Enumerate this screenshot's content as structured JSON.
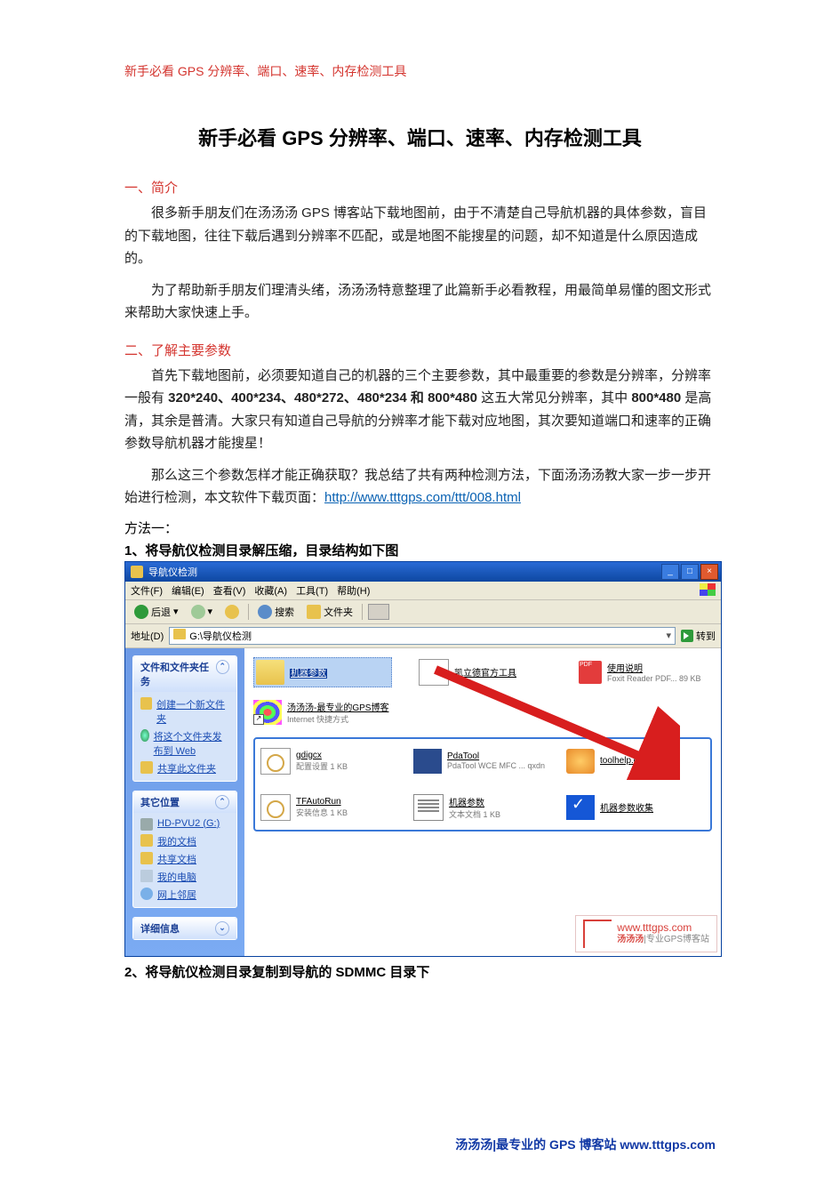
{
  "header": "新手必看 GPS 分辨率、端口、速率、内存检测工具",
  "main_title": "新手必看 GPS 分辨率、端口、速率、内存检测工具",
  "section1": {
    "heading": "一、简介",
    "p1": "很多新手朋友们在汤汤汤 GPS 博客站下载地图前，由于不清楚自己导航机器的具体参数，盲目的下载地图，往往下载后遇到分辨率不匹配，或是地图不能搜星的问题，却不知道是什么原因造成的。",
    "p2": "为了帮助新手朋友们理清头绪，汤汤汤特意整理了此篇新手必看教程，用最简单易懂的图文形式来帮助大家快速上手。"
  },
  "section2": {
    "heading": "二、了解主要参数",
    "p1_a": "首先下载地图前，必须要知道自己的机器的三个主要参数，其中最重要的参数是分辨率，分辨率一般有 ",
    "p1_bold": "320*240、400*234、480*272、480*234 和 800*480",
    "p1_b": " 这五大常见分辨率，其中 ",
    "p1_bold2": "800*480",
    "p1_c": " 是高清，其余是普清。大家只有知道自己导航的分辨率才能下载对应地图，其次要知道端口和速率的正确参数导航机器才能搜星！",
    "p2_a": "那么这三个参数怎样才能正确获取？我总结了共有两种检测方法，下面汤汤汤教大家一步一步开始进行检测，本文软件下载页面：",
    "p2_link": "http://www.tttgps.com/ttt/008.html"
  },
  "method1": {
    "label": "方法一：",
    "step1": "1、将导航仪检测目录解压缩，目录结构如下图",
    "step2": "2、将导航仪检测目录复制到导航的 SDMMC 目录下"
  },
  "footer": "汤汤汤|最专业的 GPS 博客站 www.tttgps.com",
  "xp": {
    "title": "导航仪检测",
    "menus": [
      "文件(F)",
      "编辑(E)",
      "查看(V)",
      "收藏(A)",
      "工具(T)",
      "帮助(H)"
    ],
    "toolbar": {
      "back": "后退",
      "search": "搜索",
      "folders": "文件夹"
    },
    "address_label": "地址(D)",
    "address_value": "G:\\导航仪检测",
    "go": "转到",
    "side": {
      "panel1": {
        "title": "文件和文件夹任务",
        "items": [
          "创建一个新文件夹",
          "将这个文件夹发布到 Web",
          "共享此文件夹"
        ]
      },
      "panel2": {
        "title": "其它位置",
        "items": [
          "HD-PVU2 (G:)",
          "我的文档",
          "共享文档",
          "我的电脑",
          "网上邻居"
        ]
      },
      "panel3": {
        "title": "详细信息"
      }
    },
    "files_top": [
      {
        "name": "机器参数",
        "sub": ""
      },
      {
        "name": "凯立德官方工具",
        "sub": ""
      },
      {
        "name": "使用说明",
        "sub": "Foxit Reader PDF...\n89 KB"
      }
    ],
    "files_mid": [
      {
        "name": "汤汤汤-最专业的GPS博客",
        "sub": "Internet 快捷方式"
      }
    ],
    "files_box": [
      {
        "name": "gdigcx",
        "sub": "配置设置\n1 KB"
      },
      {
        "name": "PdaTool",
        "sub": "PdaTool WCE MFC ...\nqxdn"
      },
      {
        "name": "toolhelp.dll",
        "sub": ""
      },
      {
        "name": "TFAutoRun",
        "sub": "安装信息\n1 KB"
      },
      {
        "name": "机器参数",
        "sub": "文本文档\n1 KB"
      },
      {
        "name": "机器参数收集",
        "sub": ""
      }
    ],
    "watermark": {
      "url": "www.tttgps.com",
      "tag": "汤汤汤|专业GPS博客站"
    }
  }
}
